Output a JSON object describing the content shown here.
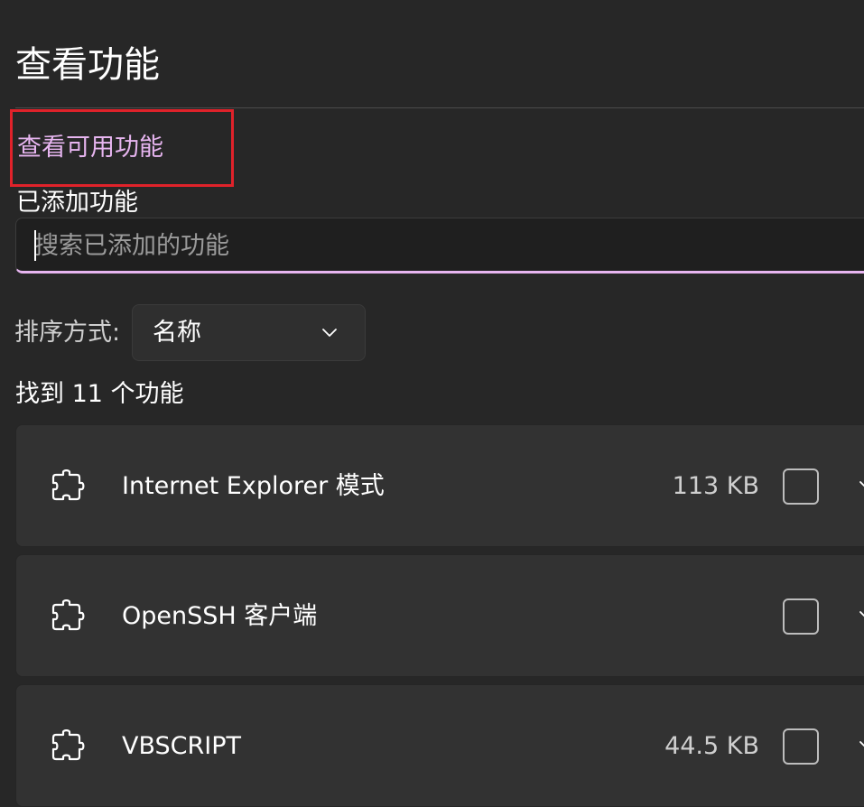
{
  "page": {
    "title": "查看功能"
  },
  "links": {
    "view_available": "查看可用功能"
  },
  "added_section": {
    "label": "已添加功能"
  },
  "search": {
    "placeholder": "搜索已添加的功能",
    "value": ""
  },
  "sort": {
    "label": "排序方式:",
    "selected": "名称"
  },
  "results": {
    "count_text": "找到 11 个功能"
  },
  "features": [
    {
      "name": "Internet Explorer 模式",
      "size": "113 KB",
      "checked": false,
      "icon": "puzzle-icon"
    },
    {
      "name": "OpenSSH 客户端",
      "size": "",
      "checked": false,
      "icon": "puzzle-icon"
    },
    {
      "name": "VBSCRIPT",
      "size": "44.5 KB",
      "checked": false,
      "icon": "puzzle-icon"
    }
  ],
  "colors": {
    "background": "#272727",
    "accent": "#e7b5f0",
    "card": "#323232",
    "highlight_box": "#e0222a"
  }
}
